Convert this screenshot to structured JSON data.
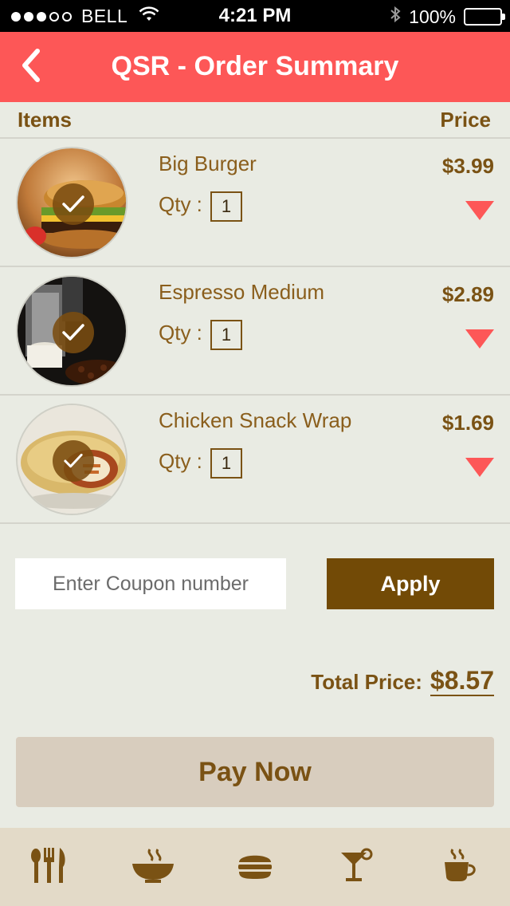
{
  "status_bar": {
    "carrier": "BELL",
    "time": "4:21 PM",
    "battery": "100%",
    "signal_icon": "signal-dots-icon",
    "wifi_icon": "wifi-icon",
    "bluetooth_icon": "bluetooth-icon",
    "battery_icon": "battery-icon"
  },
  "header": {
    "title": "QSR - Order Summary",
    "back_icon": "chevron-left-icon",
    "color": "#fd5757"
  },
  "list_header": {
    "items_label": "Items",
    "price_label": "Price"
  },
  "items": [
    {
      "name": "Big Burger",
      "qty_label": "Qty :",
      "qty": "1",
      "price": "$3.99",
      "checked": true,
      "image": "burger-photo"
    },
    {
      "name": "Espresso Medium",
      "qty_label": "Qty :",
      "qty": "1",
      "price": "$2.89",
      "checked": true,
      "image": "espresso-photo"
    },
    {
      "name": "Chicken Snack Wrap",
      "qty_label": "Qty :",
      "qty": "1",
      "price": "$1.69",
      "checked": true,
      "image": "wrap-photo"
    }
  ],
  "coupon": {
    "placeholder": "Enter Coupon number",
    "apply_label": "Apply"
  },
  "total": {
    "label": "Total Price:",
    "value": "$8.57"
  },
  "pay_button": {
    "label": "Pay Now"
  },
  "tab_bar": {
    "tabs": [
      {
        "icon": "utensils-icon"
      },
      {
        "icon": "soup-bowl-icon"
      },
      {
        "icon": "burger-icon"
      },
      {
        "icon": "cocktail-icon"
      },
      {
        "icon": "coffee-cup-icon"
      }
    ]
  },
  "colors": {
    "accent": "#fd5757",
    "brown": "#7a5214",
    "apply_bg": "#724a06",
    "background": "#e9ebe3",
    "pay_bg": "#d8cdbe",
    "tabbar_bg": "#e3dac8"
  }
}
